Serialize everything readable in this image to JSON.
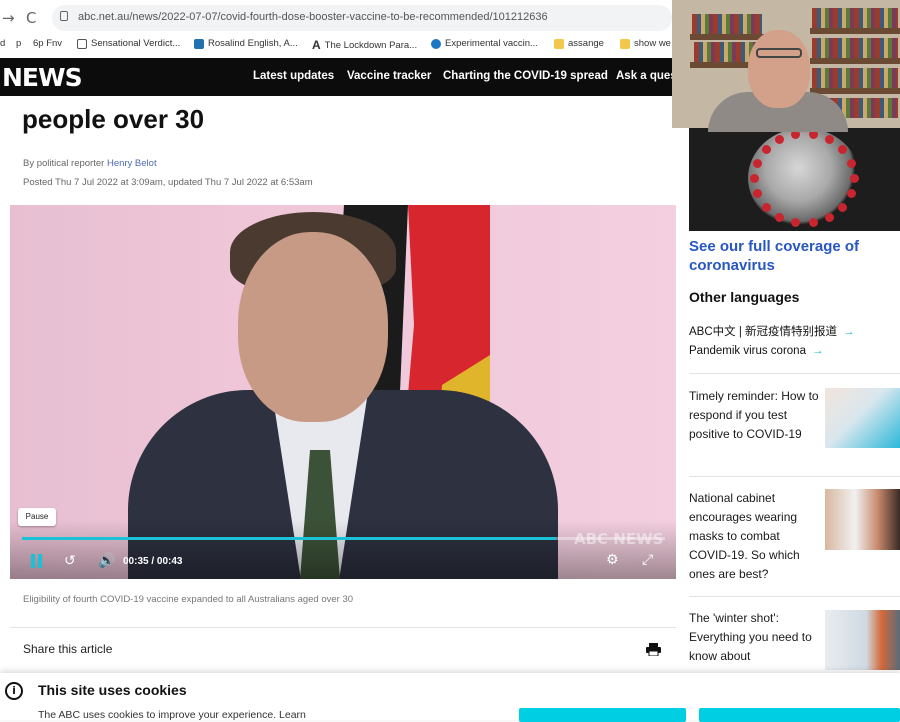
{
  "browser": {
    "nav_back": "→",
    "nav_reload": "C",
    "url": "abc.net.au/news/2022-07-07/covid-fourth-dose-booster-vaccine-to-be-recommended/101212636",
    "bookmarks": [
      {
        "label": "d"
      },
      {
        "label": "p"
      },
      {
        "label": "6p  Fnv"
      },
      {
        "label": "Sensational Verdict..."
      },
      {
        "label": "Rosalind English, A..."
      },
      {
        "label": "The Lockdown Para..."
      },
      {
        "label": "Experimental vaccin..."
      },
      {
        "label": "assange"
      },
      {
        "label": "show we"
      }
    ]
  },
  "site": {
    "logo": "NEWS",
    "nav": [
      "Latest updates",
      "Vaccine tracker",
      "Charting the COVID-19 spread",
      "Ask a ques"
    ]
  },
  "article": {
    "headline": "people over 30",
    "byline_prefix": "By political reporter",
    "byline_author": "Henry Belot",
    "posted": "Posted Thu 7 Jul 2022 at 3:09am, updated Thu 7 Jul 2022 at 6:53am",
    "caption": "Eligibility of fourth COVID-19 vaccine expanded to all Australians aged over 30",
    "share_label": "Share this article"
  },
  "video": {
    "tooltip": "Pause",
    "current_time": "00:35",
    "duration": "00:43",
    "time_separator": "/",
    "progress_fraction": 0.83,
    "watermark": "ABC NEWS",
    "accent_color": "#19c2d6"
  },
  "sidebar": {
    "coverage_link": "See our full coverage of coronavirus",
    "other_languages_title": "Other languages",
    "language_links": [
      {
        "label": "ABC中文 | 新冠疫情特别报道",
        "arrow": "→"
      },
      {
        "label": "Pandemik virus corona",
        "arrow": "→"
      }
    ],
    "stories": [
      {
        "title": "Timely reminder: How to respond if you test positive to COVID-19"
      },
      {
        "title": "National cabinet encourages wearing masks to combat COVID-19. So which ones are best?"
      },
      {
        "title": "The 'winter shot': Everything you need to know about"
      }
    ]
  },
  "cookie_banner": {
    "info_icon": "i",
    "title": "This site uses cookies",
    "text": "The ABC uses cookies to improve your experience. Learn"
  }
}
